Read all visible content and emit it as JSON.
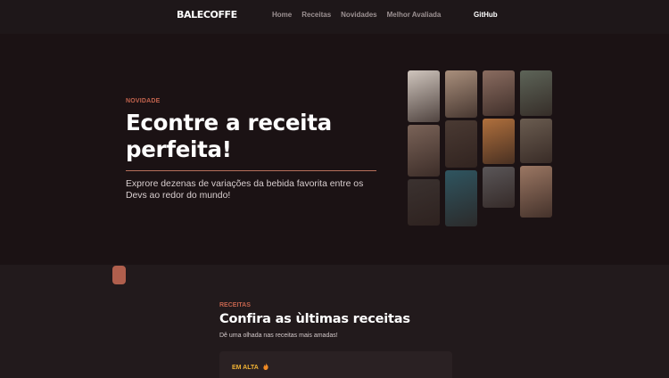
{
  "nav": {
    "brand": "BALECOFFE",
    "links": [
      "Home",
      "Receitas",
      "Novidades",
      "Melhor Avaliada"
    ],
    "github": "GitHub"
  },
  "hero": {
    "eyebrow": "NOVIDADE",
    "title": "Econtre a receita perfeita!",
    "subtitle": "Exprore dezenas de variações da bebida favorita entre os Devs ao redor do mundo!"
  },
  "gallery": {
    "images": [
      {
        "name": "pour-over-photo",
        "color": "#cfc5bd"
      },
      {
        "name": "latte-art-cup-photo",
        "color": "#a98f7c"
      },
      {
        "name": "espresso-machine-photo",
        "color": "#8a6c60"
      },
      {
        "name": "man-with-coffee-photo",
        "color": "#5d6458"
      },
      {
        "name": "coffee-beans-photo",
        "color": "#7a6358"
      },
      {
        "name": "cafe-people-photo",
        "color": "#4a3a33"
      },
      {
        "name": "iced-coffee-photo",
        "color": "#b0703d"
      },
      {
        "name": "coffee-shop-photo",
        "color": "#6a5c50"
      },
      {
        "name": "barista-pouring-photo",
        "color": "#3b3230"
      },
      {
        "name": "laptop-coffee-photo",
        "color": "#2f5560"
      },
      {
        "name": "drinks-table-photo",
        "color": "#5a5658"
      },
      {
        "name": "woman-drinking-photo",
        "color": "#9b7763"
      }
    ]
  },
  "section": {
    "eyebrow": "RECEITAS",
    "title": "Confira as ùltimas receitas",
    "subtitle": "Dê uma olhada nas receitas mais amadas!",
    "badge": "EM ALTA"
  },
  "colors": {
    "accent": "#c2634d",
    "badge": "#f0b234",
    "background": "#1b1214"
  }
}
